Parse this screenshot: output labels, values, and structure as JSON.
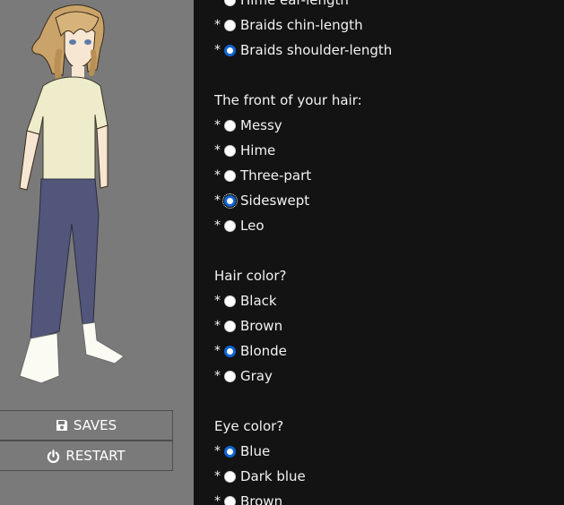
{
  "sidebar": {
    "saves_label": "SAVES",
    "restart_label": "RESTART"
  },
  "colors": {
    "sidebar_bg": "#7a7a7a",
    "main_bg": "#131313",
    "radio_checked": "#0f64d2"
  },
  "main": {
    "partial_option": {
      "label": "Hime ear-length",
      "selected": false
    },
    "hair_length_options": [
      {
        "label": "Braids chin-length",
        "selected": false
      },
      {
        "label": "Braids shoulder-length",
        "selected": true
      }
    ],
    "front_hair": {
      "question": "The front of your hair:",
      "options": [
        {
          "label": "Messy",
          "selected": false
        },
        {
          "label": "Hime",
          "selected": false
        },
        {
          "label": "Three-part",
          "selected": false
        },
        {
          "label": "Sideswept",
          "selected": true,
          "focused": true
        },
        {
          "label": "Leo",
          "selected": false
        }
      ]
    },
    "hair_color": {
      "question": "Hair color?",
      "options": [
        {
          "label": "Black",
          "selected": false
        },
        {
          "label": "Brown",
          "selected": false
        },
        {
          "label": "Blonde",
          "selected": true
        },
        {
          "label": "Gray",
          "selected": false
        }
      ]
    },
    "eye_color": {
      "question": "Eye color?",
      "options": [
        {
          "label": "Blue",
          "selected": true
        },
        {
          "label": "Dark blue",
          "selected": false
        },
        {
          "label": "Brown",
          "selected": false
        }
      ]
    },
    "star": "*"
  }
}
